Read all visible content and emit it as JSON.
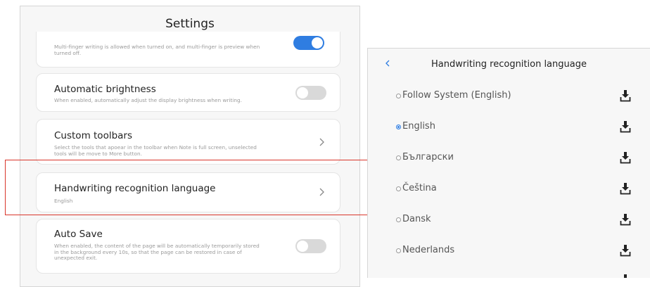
{
  "settings": {
    "title": "Settings",
    "multi_finger": {
      "description": "Multi-finger writing is allowed when turned on, and multi-finger is preview when turned off.",
      "enabled": true
    },
    "auto_brightness": {
      "title": "Automatic brightness",
      "description": "When enabled, automatically adjust the display brightness when writing.",
      "enabled": false
    },
    "custom_toolbars": {
      "title": "Custom toolbars",
      "description": "Select the tools that apoear in the toolbar when Note is full screen, unselected tools will be move to More button."
    },
    "handwriting_lang": {
      "title": "Handwriting recognition language",
      "value": "English"
    },
    "auto_save": {
      "title": "Auto Save",
      "description": "When enabled, the content of the page will be automatically temporarily stored in the background every 10s, so that the page can be restored in case of unexpected exit.",
      "enabled": false
    }
  },
  "language_panel": {
    "title": "Handwriting recognition language",
    "options": [
      {
        "label": "Follow System (English)",
        "selected": false
      },
      {
        "label": "English",
        "selected": true
      },
      {
        "label": "Български",
        "selected": false
      },
      {
        "label": "Čeština",
        "selected": false
      },
      {
        "label": "Dansk",
        "selected": false
      },
      {
        "label": "Nederlands",
        "selected": false
      }
    ]
  },
  "colors": {
    "accent": "#2f7de1",
    "highlight": "#d9362b"
  },
  "icons": {
    "back": "chevron-left-icon",
    "chevron": "chevron-right-icon",
    "download": "download-icon"
  }
}
